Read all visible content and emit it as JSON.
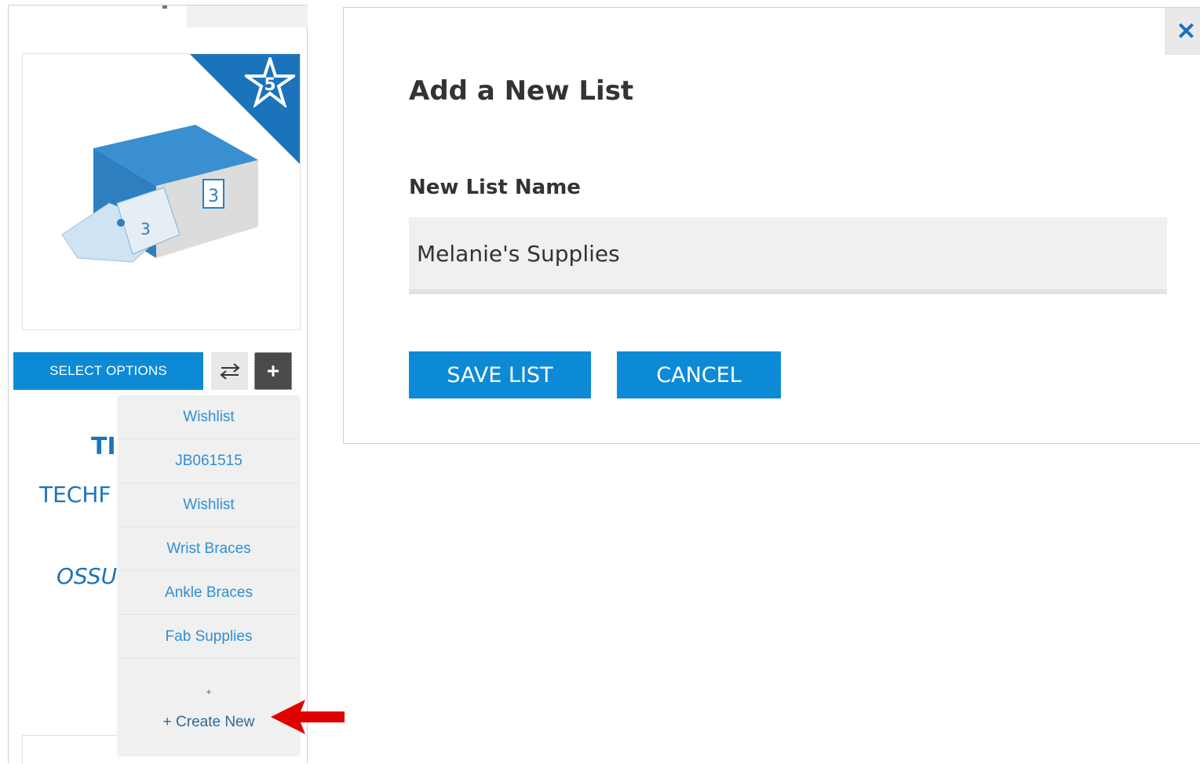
{
  "product_card": {
    "select_options_label": "SELECT OPTIONS",
    "compare_icon": "swap-arrows-icon",
    "add_to_list_icon": "plus-icon",
    "title_partial": "TI",
    "name_partial": "TECHF",
    "brand_partial": "OSSU"
  },
  "list_dropdown": {
    "items": [
      {
        "label": "Wishlist"
      },
      {
        "label": "JB061515"
      },
      {
        "label": "Wishlist"
      },
      {
        "label": "Wrist Braces"
      },
      {
        "label": "Ankle Braces"
      },
      {
        "label": "Fab Supplies"
      }
    ],
    "create_new_marker": "+",
    "create_new_label": "+ Create New"
  },
  "modal": {
    "title": "Add a New List",
    "field_label": "New List Name",
    "list_name_value": "Melanie's Supplies",
    "save_label": "SAVE LIST",
    "cancel_label": "CANCEL",
    "close_icon": "close-icon"
  },
  "colors": {
    "accent": "#0d8ad6",
    "brand_blue": "#1b73bc",
    "annotation_red": "#e00000"
  }
}
